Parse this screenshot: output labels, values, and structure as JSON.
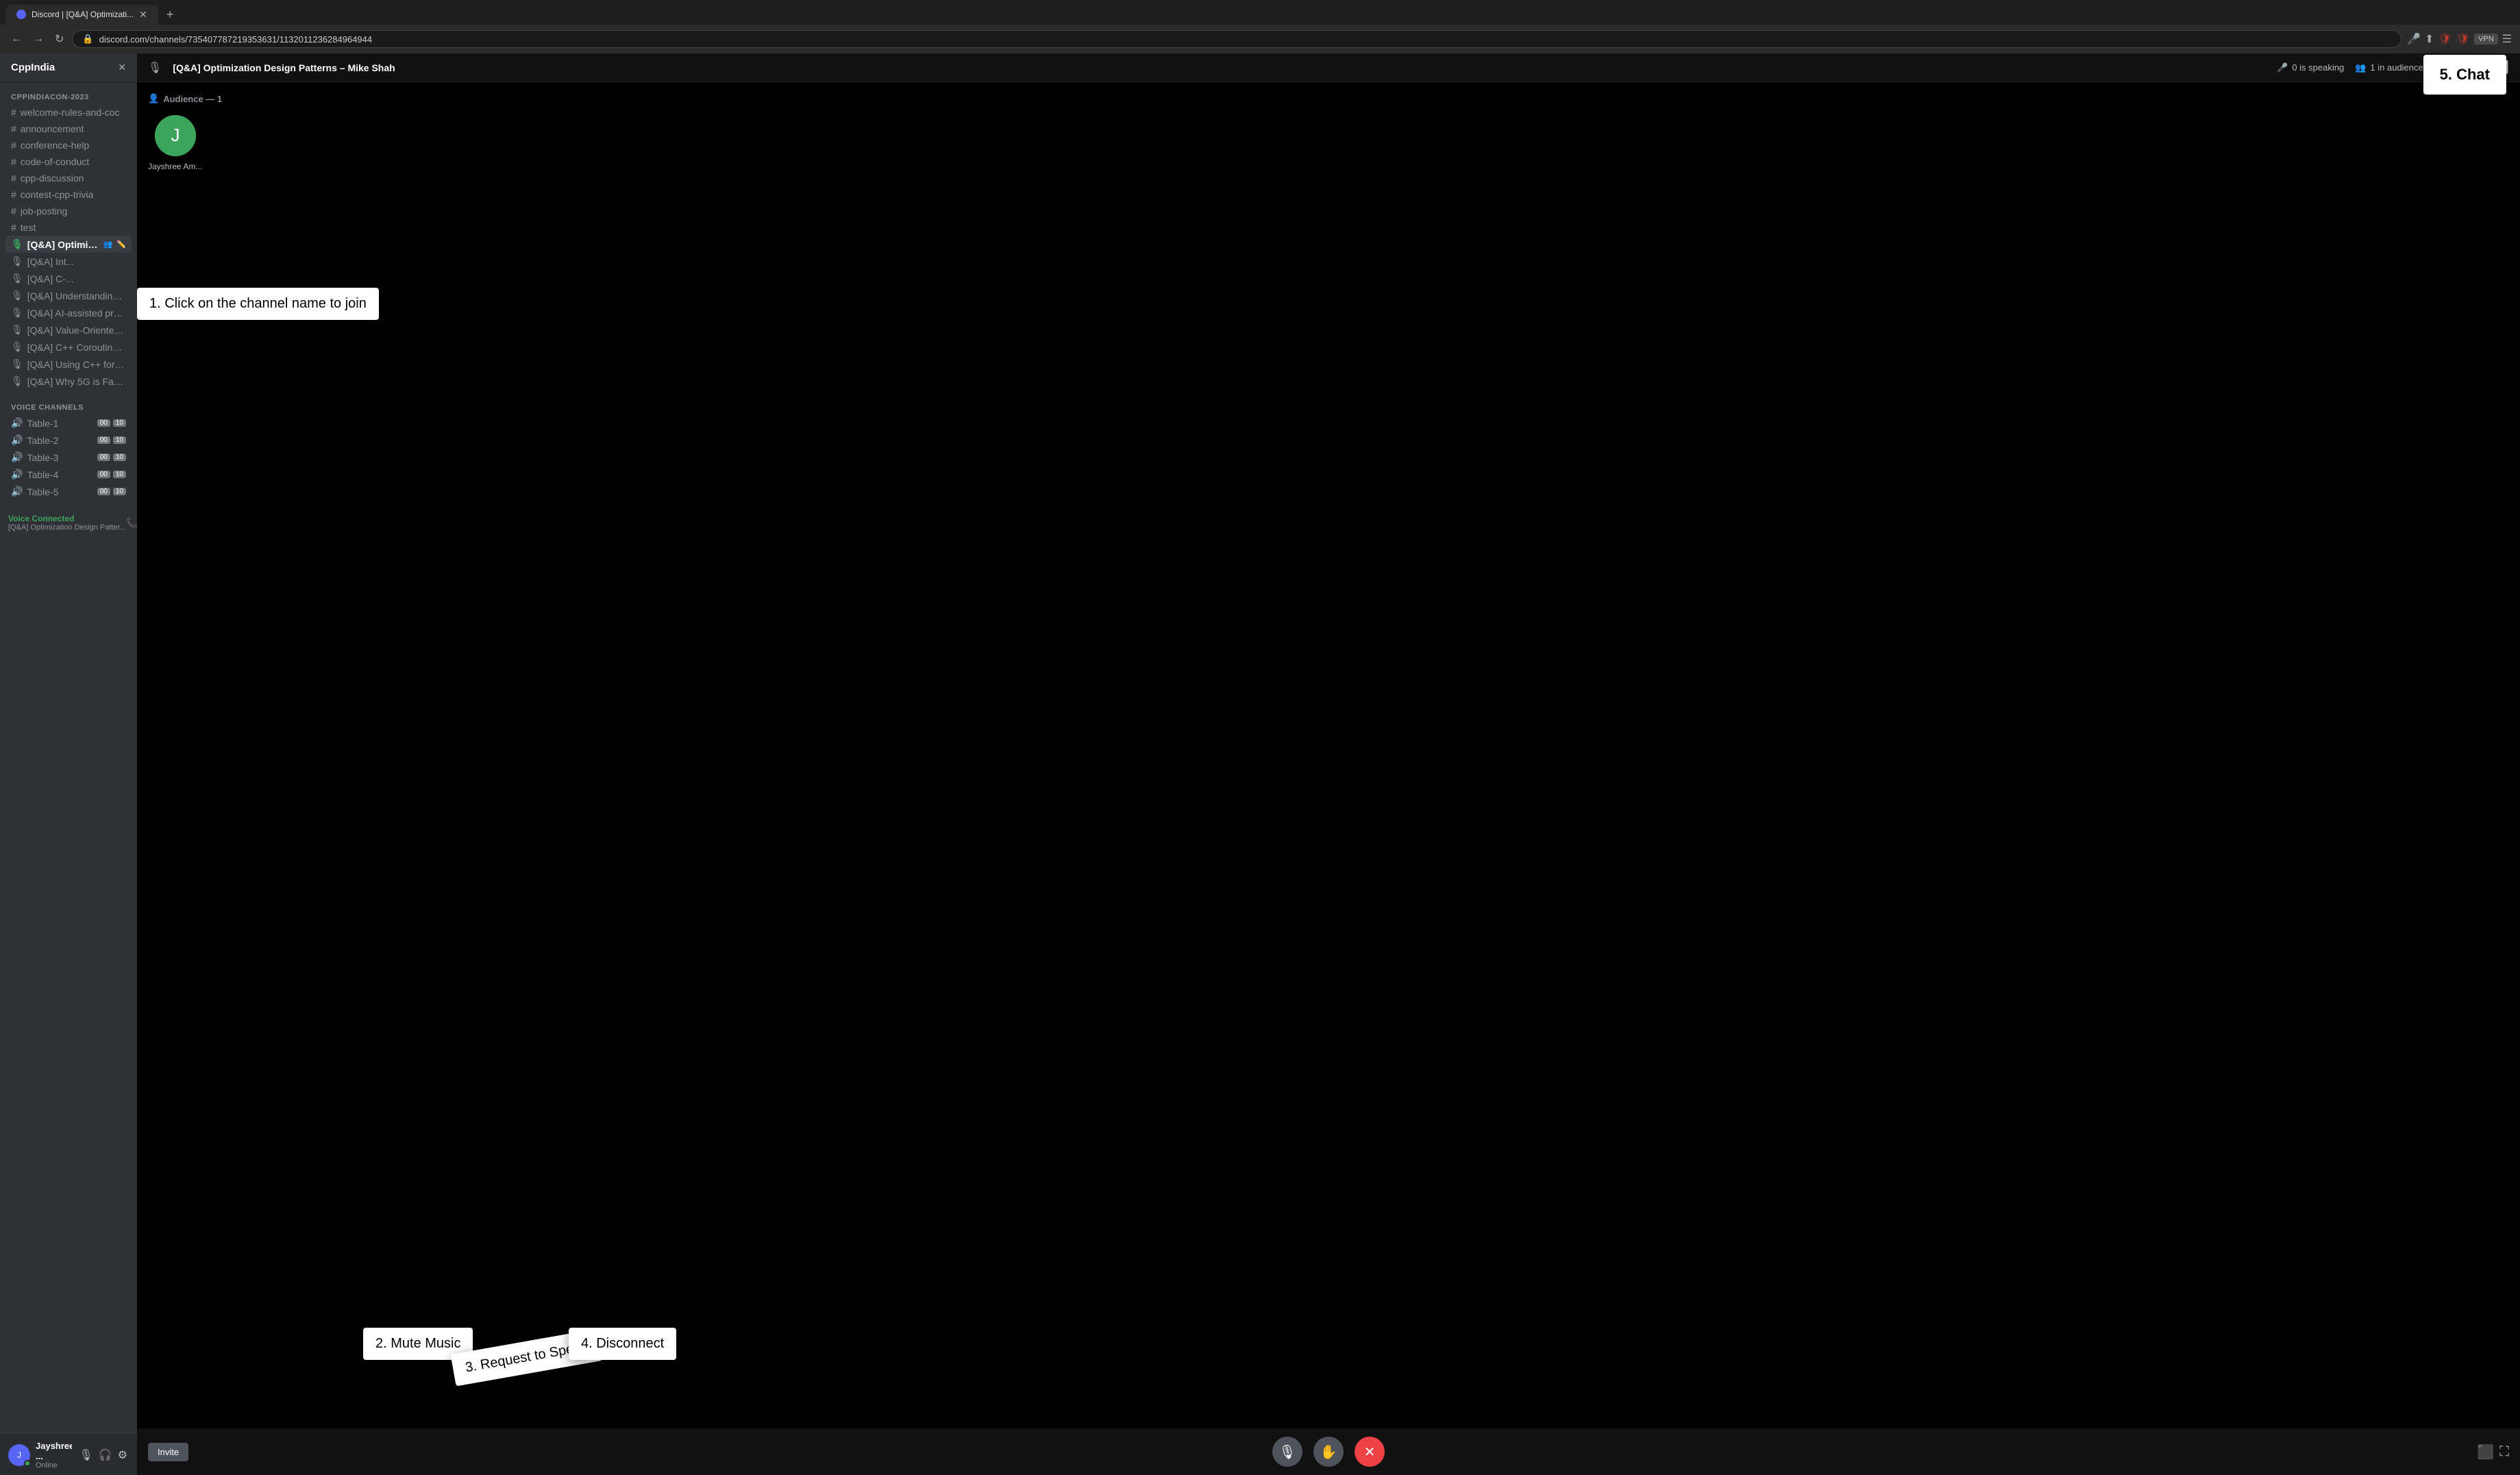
{
  "browser": {
    "tab_label": "Discord | [Q&A] Optimizati...",
    "address": "discord.com/channels/735407787219353631/1132011236284964944",
    "nav_back": "←",
    "nav_forward": "→",
    "nav_reload": "↻",
    "vpn_label": "VPN"
  },
  "sidebar": {
    "server_name": "CppIndia",
    "section_conference": "CPPINDIACON-2023",
    "channels": [
      {
        "name": "welcome-rules-and-coc",
        "type": "text",
        "active": true
      },
      {
        "name": "announcement",
        "type": "text"
      },
      {
        "name": "conference-help",
        "type": "text"
      },
      {
        "name": "code-of-conduct",
        "type": "text"
      },
      {
        "name": "cpp-discussion",
        "type": "text"
      },
      {
        "name": "contest-cpp-trivia",
        "type": "text"
      },
      {
        "name": "job-posting",
        "type": "text"
      },
      {
        "name": "test",
        "type": "text"
      },
      {
        "name": "[Q&A] Optimizatio...",
        "type": "stage",
        "active": true,
        "badges": [
          "👥",
          "✏️"
        ]
      },
      {
        "name": "[Q&A] Int...",
        "type": "stage"
      },
      {
        "name": "[Q&A] C-...",
        "type": "stage"
      },
      {
        "name": "[Q&A] Understanding co...",
        "type": "stage"
      },
      {
        "name": "[Q&A] AI-assisted progr...",
        "type": "stage"
      },
      {
        "name": "[Q&A] Value-Oriented D...",
        "type": "stage"
      },
      {
        "name": "[Q&A] C++ Coroutines fr...",
        "type": "stage"
      },
      {
        "name": "[Q&A] Using C++ for you...",
        "type": "stage"
      },
      {
        "name": "[Q&A] Why 5G is Fast? a...",
        "type": "stage"
      }
    ],
    "voice_channels": [
      {
        "name": "Table-1",
        "b1": "00",
        "b2": "10"
      },
      {
        "name": "Table-2",
        "b1": "00",
        "b2": "10"
      },
      {
        "name": "Table-3",
        "b1": "00",
        "b2": "10"
      },
      {
        "name": "Table-4",
        "b1": "00",
        "b2": "10"
      },
      {
        "name": "Table-5",
        "b1": "00",
        "b2": "10"
      }
    ],
    "voice_section_label": "VOICE CHANNELS",
    "voice_connected_label": "Voice Connected",
    "voice_channel_name": "[Q&A] Optimization Design Patter...",
    "user": {
      "name": "Jayshree ...",
      "tag": "Online",
      "avatar_initials": "J"
    }
  },
  "stage": {
    "title": "[Q&A] Optimization Design Patterns – Mike Shah",
    "speaking_count": "0 is speaking",
    "audience_count": "1 in audience",
    "audience_label": "Audience — 1",
    "audience_members": [
      {
        "name": "Jayshree Am...",
        "initials": "J"
      }
    ]
  },
  "controls": {
    "invite_label": "Invite",
    "mute_icon": "🎙",
    "hand_icon": "✋",
    "disconnect_icon": "✖"
  },
  "tooltips": {
    "tip1": "1. Click on the channel name to join",
    "tip2": "2. Mute Music",
    "tip3": "3. Request to Speak",
    "tip4": "4. Disconnect",
    "tip5": "5. Chat"
  },
  "colors": {
    "discord_purple": "#5865f2",
    "green": "#3ba55c",
    "red": "#ed4245",
    "dark_bg": "#36393f",
    "sidebar_bg": "#2f3136",
    "black": "#000000"
  }
}
